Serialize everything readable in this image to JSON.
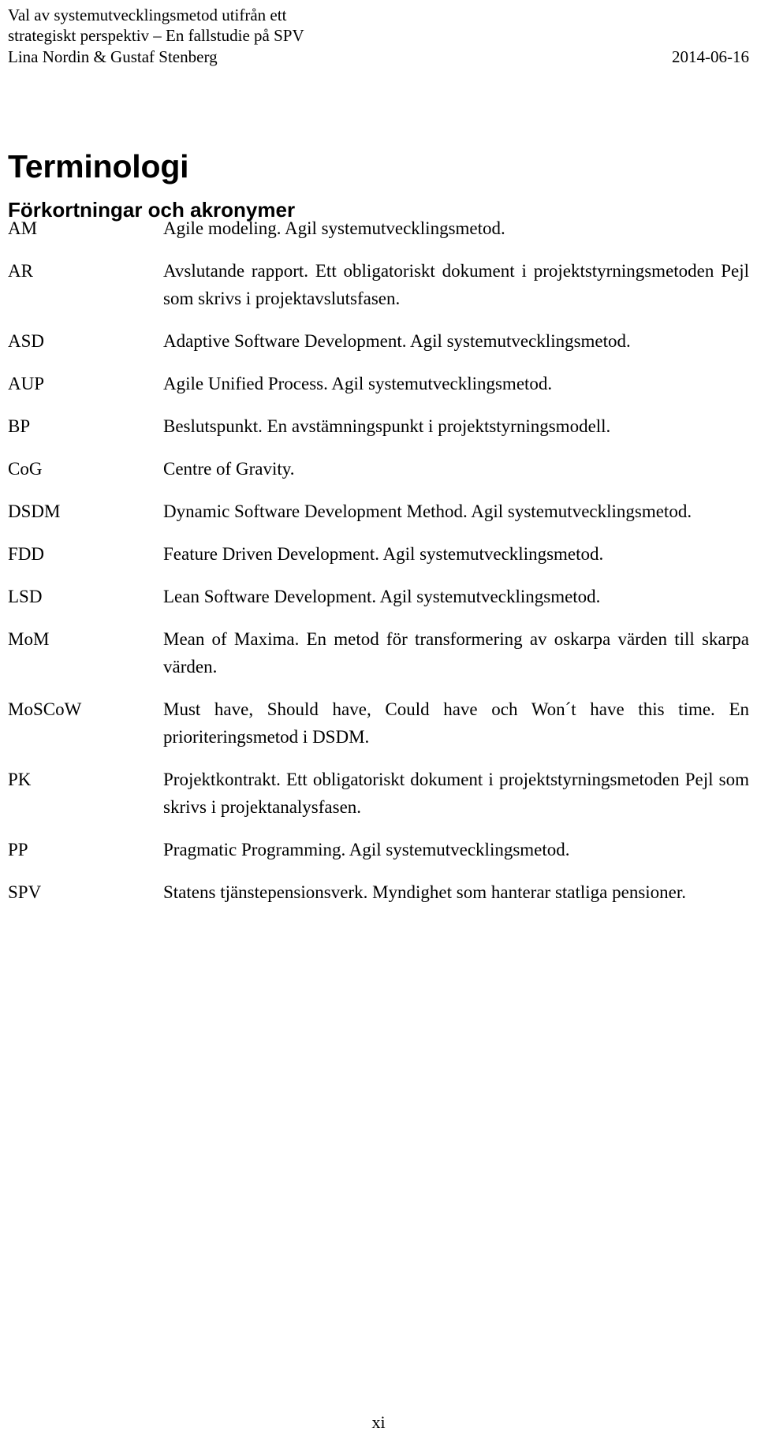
{
  "header": {
    "title_line1": "Val av systemutvecklingsmetod utifrån ett",
    "title_line2": "strategiskt perspektiv – En fallstudie på SPV",
    "authors": "Lina Nordin & Gustaf Stenberg",
    "date": "2014-06-16"
  },
  "chapter": {
    "title": "Terminologi",
    "section_title": "Förkortningar och akronymer"
  },
  "glossary": {
    "entries": [
      {
        "term": "AM",
        "definition": "Agile modeling. Agil systemutvecklingsmetod.",
        "justified": false
      },
      {
        "term": "AR",
        "definition": "Avslutande rapport. Ett obligatoriskt dokument i projektstyrningsmetoden Pejl som skrivs i projektavslutsfasen.",
        "justified": true
      },
      {
        "term": "ASD",
        "definition": "Adaptive Software Development. Agil systemutvecklingsmetod.",
        "justified": true
      },
      {
        "term": "AUP",
        "definition": "Agile Unified Process. Agil systemutvecklingsmetod.",
        "justified": false
      },
      {
        "term": "BP",
        "definition": "Beslutspunkt. En avstämningspunkt i projektstyrningsmodell.",
        "justified": true
      },
      {
        "term": "CoG",
        "definition": "Centre of Gravity.",
        "justified": false
      },
      {
        "term": "DSDM",
        "definition": "Dynamic Software Development Method. Agil systemutvecklingsmetod.",
        "justified": true
      },
      {
        "term": "FDD",
        "definition": "Feature Driven Development. Agil systemutvecklingsmetod.",
        "justified": true
      },
      {
        "term": "LSD",
        "definition": "Lean Software Development. Agil systemutvecklingsmetod.",
        "justified": true
      },
      {
        "term": "MoM",
        "definition": "Mean of Maxima.  En metod för transformering av oskarpa värden till skarpa värden.",
        "justified": true
      },
      {
        "term": "MoSCoW",
        "definition": "Must have, Should have, Could have och Won´t have this time. En prioriteringsmetod i DSDM.",
        "justified": true
      },
      {
        "term": "PK",
        "definition": "Projektkontrakt. Ett obligatoriskt dokument i projektstyrningsmetoden Pejl som skrivs i projektanalysfasen.",
        "justified": true
      },
      {
        "term": "PP",
        "definition": "Pragmatic Programming. Agil systemutvecklingsmetod.",
        "justified": false
      },
      {
        "term": "SPV",
        "definition": "Statens tjänstepensionsverk. Myndighet som hanterar statliga pensioner.",
        "justified": true
      }
    ]
  },
  "footer": {
    "page_number": "xi"
  }
}
